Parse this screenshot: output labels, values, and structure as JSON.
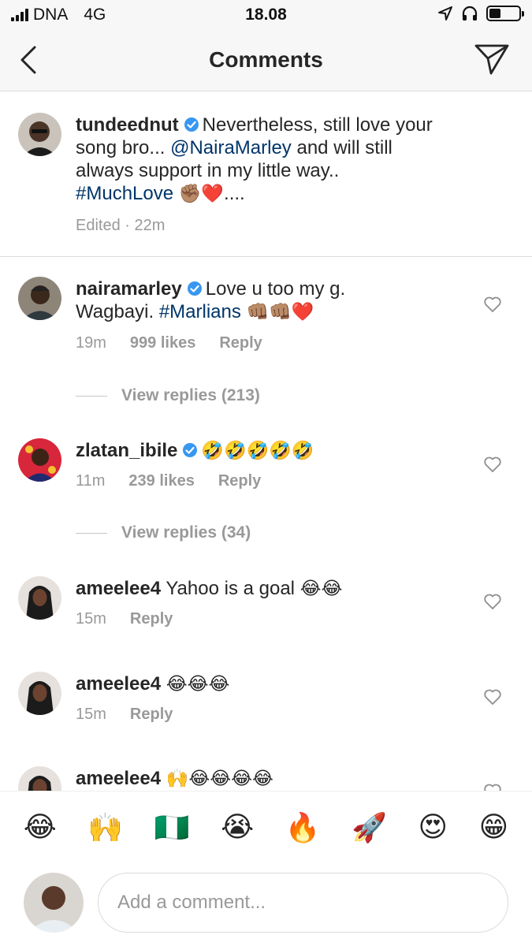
{
  "status_bar": {
    "carrier": "DNA",
    "network": "4G",
    "time": "18.08"
  },
  "header": {
    "title": "Comments",
    "back_icon": "chevron-left-icon",
    "send_icon": "paper-plane-icon"
  },
  "caption": {
    "username": "tundeednut",
    "text_1": "Nevertheless, still love your song bro... ",
    "mention": "@NairaMarley",
    "text_2": " and will still always support in my little way.. ",
    "hashtag": "#MuchLove",
    "emoji": "✊🏽❤️",
    "tail": "....",
    "meta": "Edited · 22m"
  },
  "comments": [
    {
      "username": "nairamarley",
      "text": "Love u too my g. Wagbayi. ",
      "hashtag": "#Marlians",
      "emoji": "👊🏽👊🏽❤️",
      "time": "19m",
      "likes": "999 likes",
      "reply": "Reply",
      "view_replies": "View replies (213)"
    },
    {
      "username": "zlatan_ibile",
      "emoji": "🤣🤣🤣🤣🤣",
      "time": "11m",
      "likes": "239 likes",
      "reply": "Reply",
      "view_replies": "View replies (34)"
    },
    {
      "username": "ameelee4",
      "text": "Yahoo is a goal ",
      "emoji": "😂😂",
      "time": "15m",
      "reply": "Reply"
    },
    {
      "username": "ameelee4",
      "emoji": "😂😂😂",
      "time": "15m",
      "reply": "Reply"
    },
    {
      "username": "ameelee4",
      "emoji": "🙌😂😂😂😂"
    }
  ],
  "emoji_bar": [
    "😂",
    "🙌",
    "🇳🇬",
    "😭",
    "🔥",
    "🚀",
    "😍",
    "😁"
  ],
  "composer": {
    "placeholder": "Add a comment..."
  },
  "colors": {
    "link": "#003569",
    "muted": "#999999",
    "verified": "#3897f0",
    "divider": "#dbdbdb"
  }
}
